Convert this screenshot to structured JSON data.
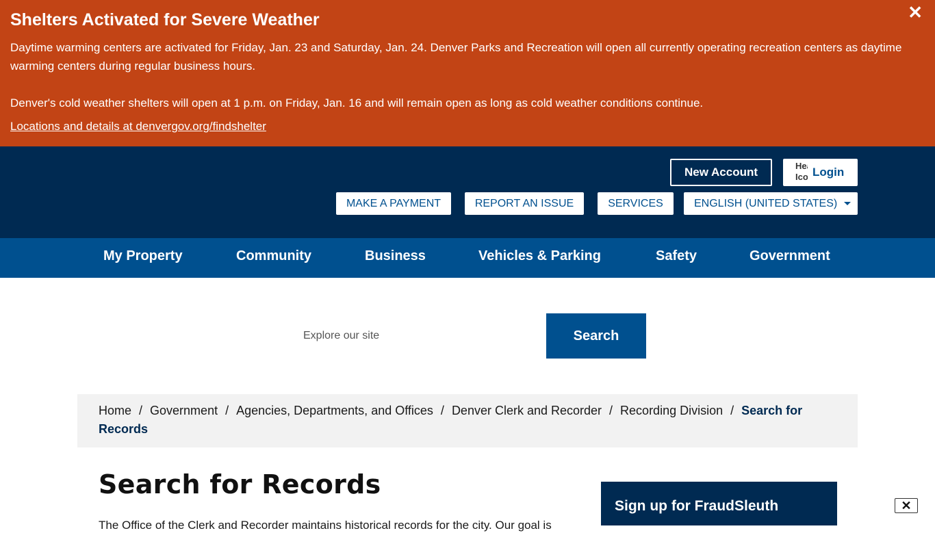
{
  "alert": {
    "title": "Shelters Activated for Severe Weather",
    "paragraph1": "Daytime warming centers are activated for Friday, Jan. 23 and Saturday, Jan. 24. Denver Parks and Recreation will open all currently operating recreation centers as daytime warming centers during regular business hours.",
    "paragraph2": "Denver's cold weather shelters will open at 1 p.m. on Friday, Jan. 16 and will remain open as long as cold weather conditions continue.",
    "link": "Locations and details at denvergov.org/findshelter",
    "close_icon": "close-icon",
    "close_glyph": "✕",
    "color": "#c24415"
  },
  "header": {
    "new_account": "New Account",
    "login": "Login",
    "login_img_alt": "Header Icon",
    "utility": [
      "MAKE A PAYMENT",
      "REPORT AN ISSUE",
      "SERVICES"
    ],
    "language": "ENGLISH (UNITED STATES)",
    "color": "#002a52"
  },
  "nav": {
    "items": [
      "My Property",
      "Community",
      "Business",
      "Vehicles & Parking",
      "Safety",
      "Government"
    ],
    "color": "#00508f"
  },
  "search": {
    "placeholder": "Explore our site",
    "button": "Search"
  },
  "breadcrumb": {
    "items": [
      "Home",
      "Government",
      "Agencies, Departments, and Offices",
      "Denver Clerk and Recorder",
      "Recording Division"
    ],
    "separator": "/",
    "current_line1": "Search for",
    "current_line2": "Records"
  },
  "main": {
    "title": "Search for Records",
    "intro": "The Office of the Clerk and Recorder maintains historical records for the city. Our goal is"
  },
  "sidebar": {
    "card_title": "Sign up for FraudSleuth"
  },
  "floating": {
    "close_glyph": "✕"
  }
}
